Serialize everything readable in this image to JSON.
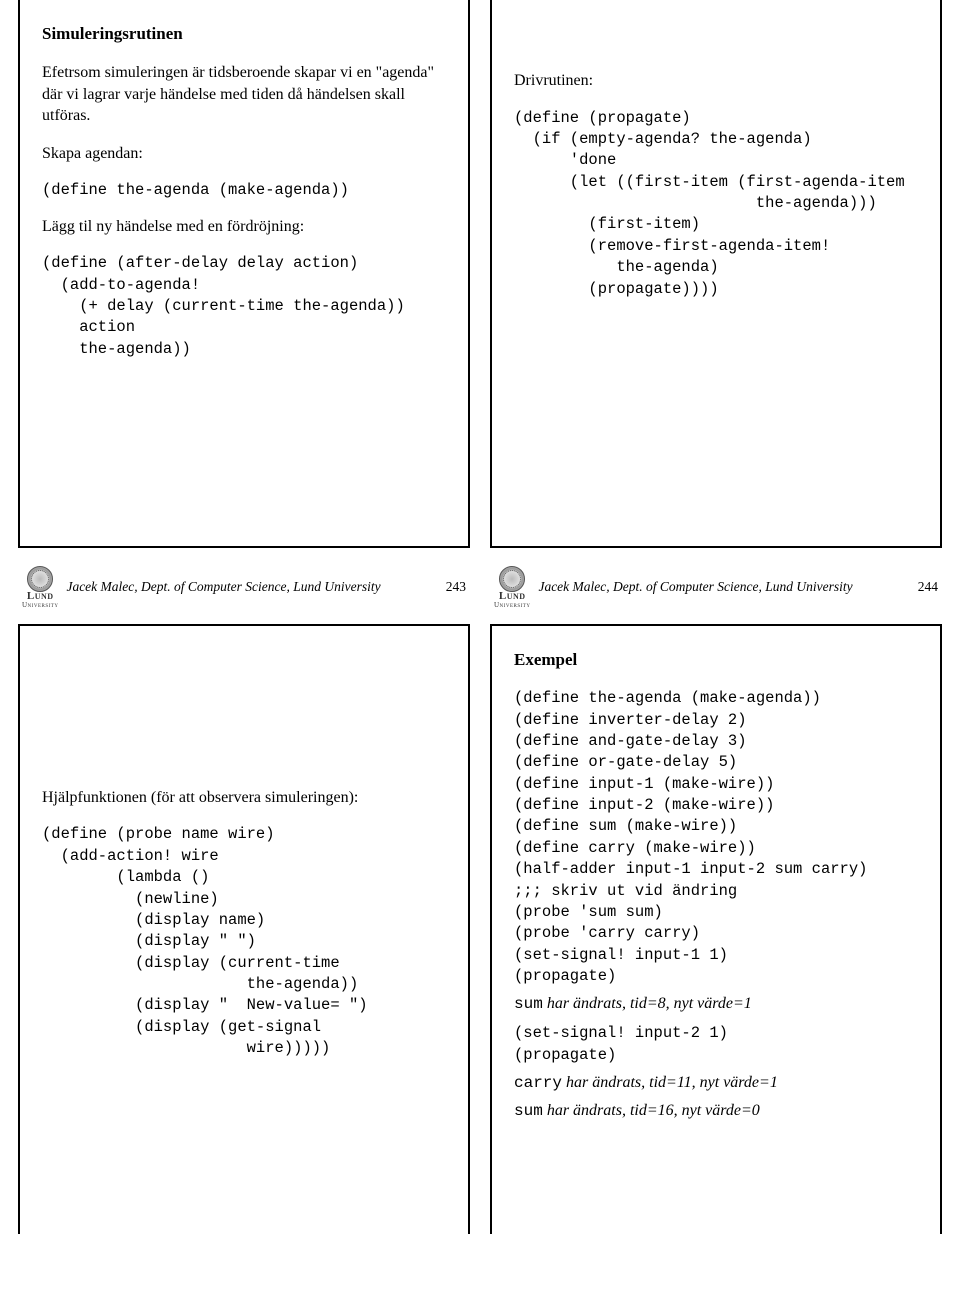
{
  "slide1": {
    "title": "Simuleringsrutinen",
    "para1": "Efetrsom simuleringen är tidsberoende skapar vi en \"agenda\" där vi lagrar varje händelse med tiden då händelsen skall utföras.",
    "para2": "Skapa agendan:",
    "code1": "(define the-agenda (make-agenda))",
    "para3": "Lägg til ny händelse med en fördröjning:",
    "code2": "(define (after-delay delay action)\n  (add-to-agenda!\n    (+ delay (current-time the-agenda))\n    action\n    the-agenda))"
  },
  "slide2": {
    "para1": "Drivrutinen:",
    "code1": "(define (propagate)\n  (if (empty-agenda? the-agenda)\n      'done\n      (let ((first-item (first-agenda-item\n                          the-agenda)))\n        (first-item)\n        (remove-first-agenda-item!\n           the-agenda)\n        (propagate))))"
  },
  "slide3": {
    "para1": "Hjälpfunktionen (för att observera simuleringen):",
    "code1": "(define (probe name wire)\n  (add-action! wire\n        (lambda ()\n          (newline)\n          (display name)\n          (display \" \")\n          (display (current-time\n                      the-agenda))\n          (display \"  New-value= \")\n          (display (get-signal\n                      wire)))))"
  },
  "slide4": {
    "title": "Exempel",
    "code1": "(define the-agenda (make-agenda))\n(define inverter-delay 2)\n(define and-gate-delay 3)\n(define or-gate-delay 5)\n(define input-1 (make-wire))\n(define input-2 (make-wire))\n(define sum (make-wire))\n(define carry (make-wire))\n(half-adder input-1 input-2 sum carry)\n;;; skriv ut vid ändring\n(probe 'sum sum)\n(probe 'carry carry)\n(set-signal! input-1 1)\n(propagate)",
    "ital1_pre": "sum",
    "ital1_rest": " har ändrats, tid=8, nyt värde=1",
    "code2": "(set-signal! input-2 1)\n(propagate)",
    "ital2_pre": "carry",
    "ital2_rest": " har ändrats, tid=11, nyt värde=1",
    "ital3_pre": "sum",
    "ital3_rest": " har ändrats, tid=16, nyt värde=0"
  },
  "footer": {
    "author": "Jacek Malec, Dept. of Computer Science, Lund University",
    "pages": [
      "243",
      "244"
    ],
    "logo_line1": "Lund",
    "logo_line2": "University"
  }
}
